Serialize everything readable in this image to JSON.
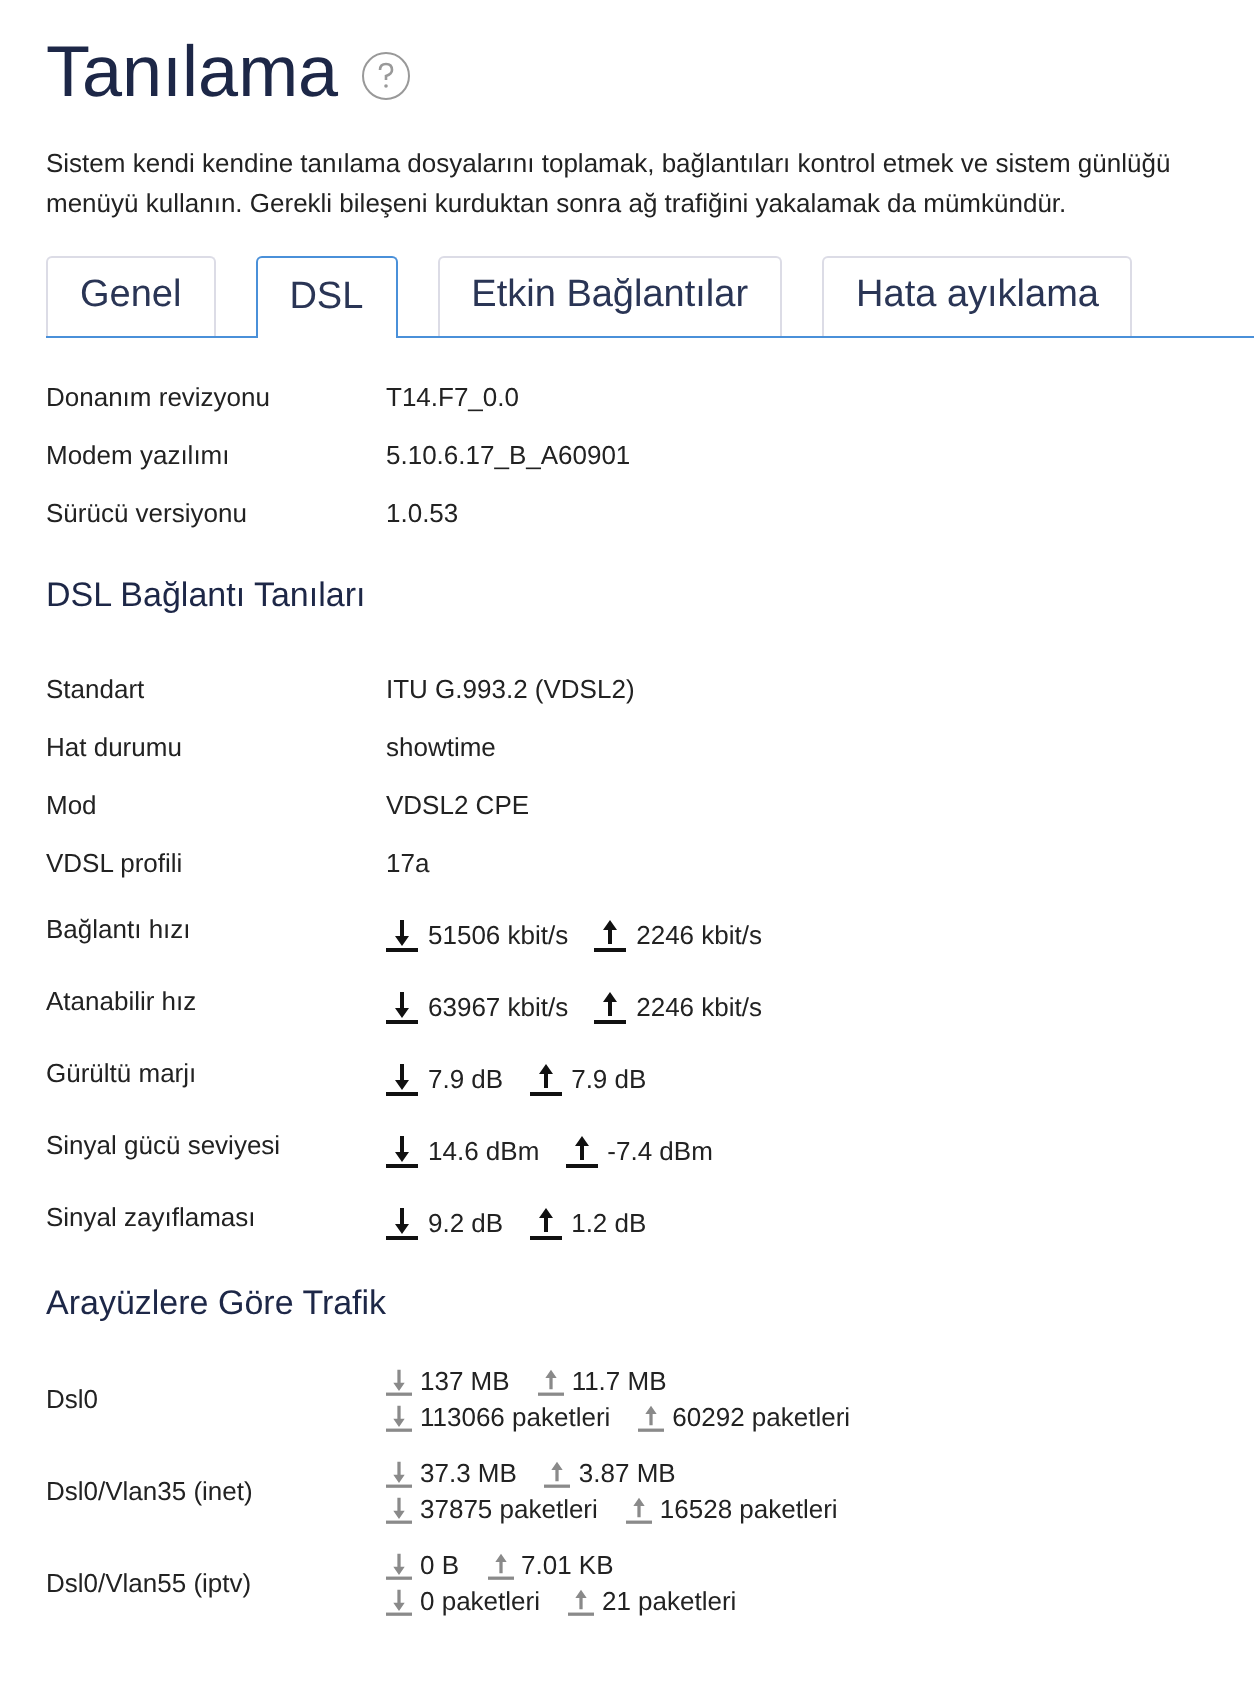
{
  "title": "Tanılama",
  "description": [
    "Sistem kendi kendine tanılama dosyalarını toplamak, bağlantıları kontrol etmek ve sistem günlüğü",
    "menüyü kullanın. Gerekli bileşeni kurduktan sonra ağ trafiğini yakalamak da mümkündür."
  ],
  "tabs": [
    {
      "label": "Genel",
      "selected": false
    },
    {
      "label": "DSL",
      "selected": true
    },
    {
      "label": "Etkin Bağlantılar",
      "selected": false
    },
    {
      "label": "Hata ayıklama",
      "selected": false
    }
  ],
  "info": [
    {
      "label": "Donanım revizyonu",
      "value": "T14.F7_0.0"
    },
    {
      "label": "Modem yazılımı",
      "value": "5.10.6.17_B_A60901"
    },
    {
      "label": "Sürücü versiyonu",
      "value": "1.0.53"
    }
  ],
  "dsl_section": {
    "heading": "DSL Bağlantı Tanıları",
    "rows": [
      {
        "kind": "text",
        "label": "Standart",
        "value": "ITU G.993.2 (VDSL2)"
      },
      {
        "kind": "text",
        "label": "Hat durumu",
        "value": "showtime"
      },
      {
        "kind": "text",
        "label": "Mod",
        "value": "VDSL2 CPE"
      },
      {
        "kind": "text",
        "label": "VDSL profili",
        "value": "17a"
      },
      {
        "kind": "updown",
        "label": "Bağlantı hızı",
        "down": "51506 kbit/s",
        "up": "2246 kbit/s"
      },
      {
        "kind": "updown",
        "label": "Atanabilir hız",
        "down": "63967 kbit/s",
        "up": "2246 kbit/s"
      },
      {
        "kind": "updown",
        "label": "Gürültü marjı",
        "down": "7.9 dB",
        "up": "7.9 dB"
      },
      {
        "kind": "updown",
        "label": "Sinyal gücü seviyesi",
        "down": "14.6 dBm",
        "up": "-7.4 dBm"
      },
      {
        "kind": "updown",
        "label": "Sinyal zayıflaması",
        "down": "9.2 dB",
        "up": "1.2 dB"
      }
    ]
  },
  "traffic_section": {
    "heading": "Arayüzlere Göre Trafik",
    "rows": [
      {
        "label": "Dsl0",
        "bytes_down": "137 MB",
        "bytes_up": "11.7 MB",
        "packets_down": "113066 paketleri",
        "packets_up": "60292 paketleri"
      },
      {
        "label": "Dsl0/Vlan35 (inet)",
        "bytes_down": "37.3 MB",
        "bytes_up": "3.87 MB",
        "packets_down": "37875 paketleri",
        "packets_up": "16528 paketleri"
      },
      {
        "label": "Dsl0/Vlan55 (iptv)",
        "bytes_down": "0 B",
        "bytes_up": "7.01 KB",
        "packets_down": "0 paketleri",
        "packets_up": "21 paketleri"
      }
    ]
  }
}
